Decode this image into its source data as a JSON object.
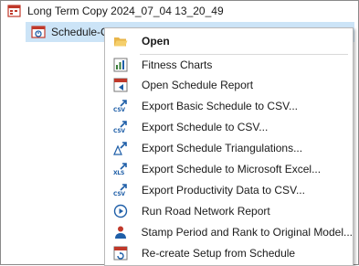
{
  "tree": {
    "row1": {
      "label": "Long Term Copy 2024_07_04 13_20_49",
      "icon": "schedule-folder-icon"
    },
    "row2": {
      "label": "Schedule-C",
      "icon": "schedule-icon"
    }
  },
  "menu": {
    "items": [
      {
        "label": "Open",
        "icon": "folder-open-icon",
        "bold": true
      },
      {
        "label": "Fitness Charts",
        "icon": "chart-icon"
      },
      {
        "label": "Open Schedule Report",
        "icon": "report-icon"
      },
      {
        "label": "Export Basic Schedule to CSV...",
        "icon": "export-csv-icon"
      },
      {
        "label": "Export Schedule to CSV...",
        "icon": "export-csv-icon"
      },
      {
        "label": "Export Schedule Triangulations...",
        "icon": "triangulation-export-icon"
      },
      {
        "label": "Export Schedule to Microsoft Excel...",
        "icon": "export-xls-icon"
      },
      {
        "label": "Export Productivity Data to CSV...",
        "icon": "export-csv-icon"
      },
      {
        "label": "Run Road Network Report",
        "icon": "play-circle-icon"
      },
      {
        "label": "Stamp Period and Rank to Original Model...",
        "icon": "person-icon"
      },
      {
        "label": "Re-create Setup from Schedule",
        "icon": "recreate-setup-icon"
      }
    ]
  },
  "colors": {
    "selection": "#cce4f7",
    "csv_blue": "#1f5fa8",
    "accent_red": "#c0392b"
  }
}
